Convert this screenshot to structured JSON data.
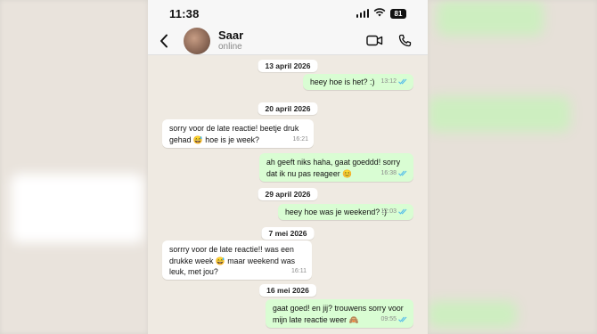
{
  "status_bar": {
    "time": "11:38",
    "battery": "81"
  },
  "header": {
    "name": "Saar",
    "status": "online"
  },
  "colors": {
    "outgoing": "#d9fdd3",
    "incoming": "#ffffff",
    "read_ticks": "#53bdeb",
    "chat_bg": "#efeae2"
  },
  "icons": [
    "back-arrow-icon",
    "video-call-icon",
    "phone-call-icon",
    "signal-icon",
    "wifi-icon",
    "battery-icon",
    "double-check-icon"
  ],
  "messages": [
    {
      "type": "date",
      "text": "13 april 2026"
    },
    {
      "type": "out",
      "text": "heey hoe is het? :)",
      "time": "13:12"
    },
    {
      "type": "date",
      "text": "20 april 2026"
    },
    {
      "type": "in",
      "text": "sorry voor de late reactie! beetje druk gehad 😅 hoe is je week?",
      "time": "16:21"
    },
    {
      "type": "out",
      "text": "ah geeft niks haha, gaat goeddd! sorry dat ik nu pas reageer 😊",
      "time": "16:38"
    },
    {
      "type": "date",
      "text": "29 april 2026"
    },
    {
      "type": "out",
      "text": "heey hoe was je weekend? :)",
      "time": "12:03"
    },
    {
      "type": "date",
      "text": "7 mei 2026"
    },
    {
      "type": "in",
      "text": "sorrry voor de late reactie!! was een drukke week 😅 maar weekend was leuk, met jou?",
      "time": "16:11"
    },
    {
      "type": "date",
      "text": "16 mei 2026"
    },
    {
      "type": "out",
      "text": "gaat goed! en jij? trouwens sorry voor mijn late reactie weer 🙈",
      "time": "09:55"
    }
  ]
}
